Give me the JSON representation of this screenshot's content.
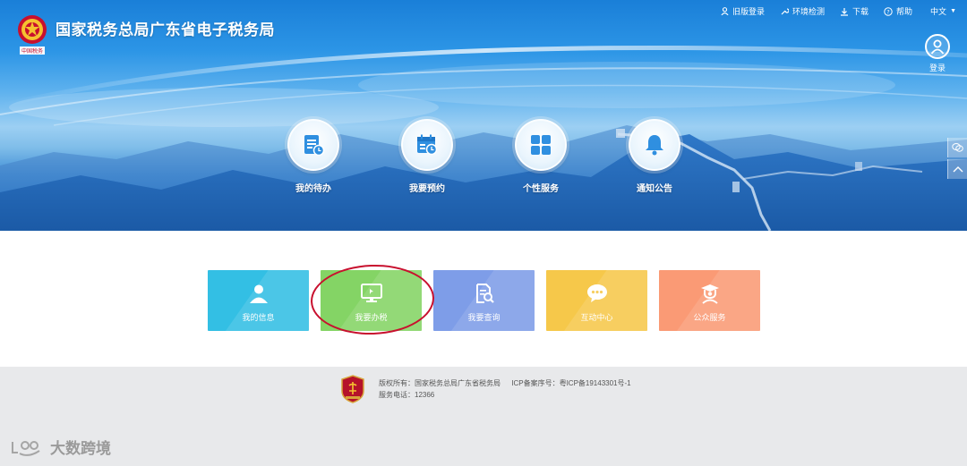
{
  "header": {
    "title": "国家税务总局广东省电子税务局",
    "emblem_caption": "中国税务"
  },
  "topnav": {
    "items": [
      {
        "label": "旧版登录",
        "icon": "user-icon"
      },
      {
        "label": "环境检测",
        "icon": "wrench-icon"
      },
      {
        "label": "下载",
        "icon": "download-icon"
      },
      {
        "label": "帮助",
        "icon": "help-icon"
      }
    ],
    "language": "中文"
  },
  "login": {
    "label": "登录"
  },
  "hero_menu": [
    {
      "label": "我的待办",
      "icon": "todo-list-icon"
    },
    {
      "label": "我要预约",
      "icon": "calendar-icon"
    },
    {
      "label": "个性服务",
      "icon": "grid-icon"
    },
    {
      "label": "通知公告",
      "icon": "bell-icon"
    }
  ],
  "side_tools": [
    {
      "icon": "chat-icon"
    },
    {
      "icon": "chevron-up-icon"
    }
  ],
  "tiles": [
    {
      "label": "我的信息",
      "icon": "person-icon",
      "color": "#33bfe4"
    },
    {
      "label": "我要办税",
      "icon": "monitor-icon",
      "color": "#84d465"
    },
    {
      "label": "我要查询",
      "icon": "document-search-icon",
      "color": "#7e9de8"
    },
    {
      "label": "互动中心",
      "icon": "chat-bubble-icon",
      "color": "#f6c84a"
    },
    {
      "label": "公众服务",
      "icon": "graduate-icon",
      "color": "#fa9a75"
    }
  ],
  "highlight_color": "#c8102e",
  "footer": {
    "copyright_label": "版权所有：国家税务总局广东省税务局",
    "icp": "ICP备案序号：粤ICP备19143301号-1",
    "service_phone": "服务电话：12366"
  },
  "watermark": {
    "text": "大数跨境"
  }
}
